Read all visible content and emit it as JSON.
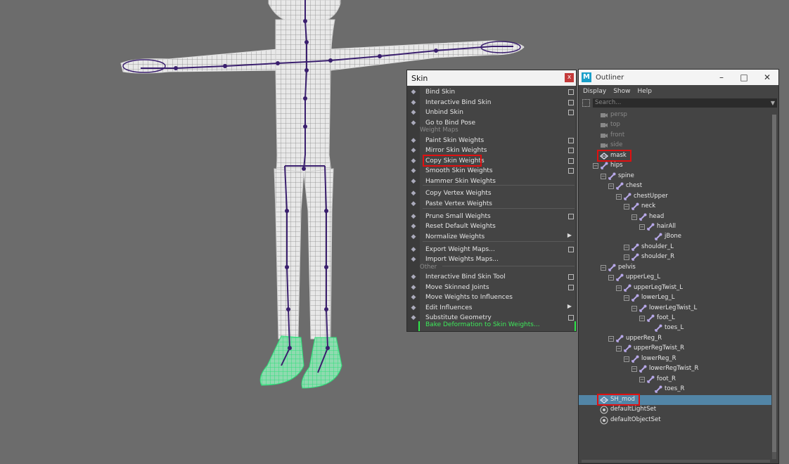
{
  "skin_menu": {
    "title": "Skin",
    "close_label": "x",
    "items": [
      {
        "label": "Bind Skin",
        "icon": "bind-skin-icon",
        "option": true
      },
      {
        "label": "Interactive Bind Skin",
        "icon": "interactive-bind-icon",
        "option": true
      },
      {
        "label": "Unbind Skin",
        "icon": "unbind-skin-icon",
        "option": true
      },
      {
        "label": "Go to Bind Pose",
        "icon": "bind-pose-icon",
        "option": false
      }
    ],
    "weight_maps_header": "Weight Maps",
    "weight_items": [
      {
        "label": "Paint Skin Weights",
        "option": true
      },
      {
        "label": "Mirror Skin Weights",
        "option": true
      },
      {
        "label": "Copy Skin Weights",
        "option": true
      },
      {
        "label": "Smooth Skin Weights",
        "option": true
      },
      {
        "label": "Hammer Skin Weights",
        "option": false
      },
      {
        "label": "Copy Vertex Weights",
        "option": false
      },
      {
        "label": "Paste Vertex Weights",
        "option": false
      },
      {
        "label": "Prune Small Weights",
        "option": true
      },
      {
        "label": "Reset Default Weights",
        "option": false
      },
      {
        "label": "Normalize Weights",
        "option": false
      },
      {
        "label": "Export Weight Maps...",
        "option": true
      },
      {
        "label": "Import Weights Maps...",
        "option": false
      }
    ],
    "other_header": "Other",
    "other_items": [
      {
        "label": "Interactive Bind Skin Tool",
        "option": true
      },
      {
        "label": "Move Skinned Joints",
        "option": true
      },
      {
        "label": "Move Weights to Influences",
        "option": false
      },
      {
        "label": "Edit Influences",
        "option": false
      },
      {
        "label": "Substitute Geometry",
        "option": true
      }
    ],
    "bake_label": "Bake Deformation to Skin Weights..."
  },
  "outliner": {
    "title": "Outliner",
    "menus": [
      "Display",
      "Show",
      "Help"
    ],
    "search_placeholder": "Search...",
    "nodes": [
      {
        "label": "persp",
        "depth": 0,
        "type": "camera",
        "dim": true
      },
      {
        "label": "top",
        "depth": 0,
        "type": "camera",
        "dim": true
      },
      {
        "label": "front",
        "depth": 0,
        "type": "camera",
        "dim": true
      },
      {
        "label": "side",
        "depth": 0,
        "type": "camera",
        "dim": true
      },
      {
        "label": "mask",
        "depth": 0,
        "type": "mesh",
        "boxed": true
      },
      {
        "label": "hips",
        "depth": 0,
        "type": "joint",
        "expand": true
      },
      {
        "label": "spine",
        "depth": 1,
        "type": "joint",
        "expand": true
      },
      {
        "label": "chest",
        "depth": 2,
        "type": "joint",
        "expand": true
      },
      {
        "label": "chestUpper",
        "depth": 3,
        "type": "joint",
        "expand": true
      },
      {
        "label": "neck",
        "depth": 4,
        "type": "joint",
        "expand": true
      },
      {
        "label": "head",
        "depth": 5,
        "type": "joint",
        "expand": true
      },
      {
        "label": "hairAll",
        "depth": 6,
        "type": "joint",
        "expand": true
      },
      {
        "label": "jBone",
        "depth": 7,
        "type": "joint"
      },
      {
        "label": "shoulder_L",
        "depth": 4,
        "type": "joint",
        "expand": true
      },
      {
        "label": "shoulder_R",
        "depth": 4,
        "type": "joint",
        "expand": true
      },
      {
        "label": "pelvis",
        "depth": 1,
        "type": "joint",
        "expand": true
      },
      {
        "label": "upperLeg_L",
        "depth": 2,
        "type": "joint",
        "expand": true
      },
      {
        "label": "upperLegTwist_L",
        "depth": 3,
        "type": "joint",
        "expand": true
      },
      {
        "label": "lowerLeg_L",
        "depth": 4,
        "type": "joint",
        "expand": true
      },
      {
        "label": "lowerLegTwist_L",
        "depth": 5,
        "type": "joint",
        "expand": true
      },
      {
        "label": "foot_L",
        "depth": 6,
        "type": "joint",
        "expand": true
      },
      {
        "label": "toes_L",
        "depth": 7,
        "type": "joint"
      },
      {
        "label": "upperReg_R",
        "depth": 2,
        "type": "joint",
        "expand": true
      },
      {
        "label": "upperRegTwist_R",
        "depth": 3,
        "type": "joint",
        "expand": true
      },
      {
        "label": "lowerReg_R",
        "depth": 4,
        "type": "joint",
        "expand": true
      },
      {
        "label": "lowerRegTwist_R",
        "depth": 5,
        "type": "joint",
        "expand": true
      },
      {
        "label": "foot_R",
        "depth": 6,
        "type": "joint",
        "expand": true
      },
      {
        "label": "toes_R",
        "depth": 7,
        "type": "joint"
      },
      {
        "label": "SH_mod",
        "depth": 0,
        "type": "mesh",
        "selected": true,
        "boxed": true
      },
      {
        "label": "defaultLightSet",
        "depth": 0,
        "type": "set"
      },
      {
        "label": "defaultObjectSet",
        "depth": 0,
        "type": "set"
      }
    ]
  },
  "colors": {
    "viewport_bg": "#6c6c6c",
    "mesh_wire": "#ffffff",
    "joint": "#3a1f6e",
    "shoe_wire": "#3df08a",
    "highlight_box": "#e01010",
    "bake_green": "#3de85a",
    "selection": "#5285a6"
  }
}
